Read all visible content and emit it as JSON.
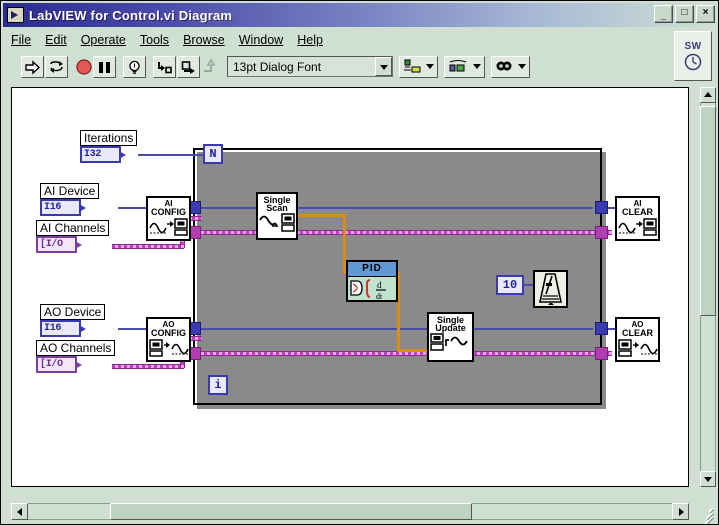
{
  "window": {
    "title": "LabVIEW for Control.vi Diagram",
    "icon": "labview-vi-icon",
    "buttons": [
      {
        "name": "minimize",
        "glyph": "_"
      },
      {
        "name": "maximize",
        "glyph": "□"
      },
      {
        "name": "close",
        "glyph": "×"
      }
    ]
  },
  "menu": {
    "items": [
      {
        "label": "File",
        "mnemonic": "F"
      },
      {
        "label": "Edit",
        "mnemonic": "E"
      },
      {
        "label": "Operate",
        "mnemonic": "O"
      },
      {
        "label": "Tools",
        "mnemonic": "T"
      },
      {
        "label": "Browse",
        "mnemonic": "B"
      },
      {
        "label": "Window",
        "mnemonic": "W"
      },
      {
        "label": "Help",
        "mnemonic": "H"
      }
    ]
  },
  "toolbar": {
    "run_icon": "run-arrow-icon",
    "run_continuous_icon": "run-continuously-icon",
    "abort_icon": "abort-execution-icon",
    "pause_icon": "pause-icon",
    "highlight_icon": "highlight-execution-lightbulb-icon",
    "step_into_icon": "step-into-icon",
    "step_over_icon": "step-over-icon",
    "step_out_icon": "step-out-icon",
    "font": {
      "value": "13pt Dialog Font",
      "dropdown_icon": "chevron-down-icon"
    },
    "align_objects_icon": "align-objects-icon",
    "distribute_objects_icon": "distribute-objects-icon",
    "reorder_icon": "reorder-objects-icon",
    "status_badge": {
      "label": "SW",
      "icon": "clock-icon"
    }
  },
  "diagram": {
    "terminals": [
      {
        "name": "iterations",
        "label": "Iterations",
        "type": "I32",
        "kind": "numeric"
      },
      {
        "name": "ai-device",
        "label": "AI Device",
        "type": "I16",
        "kind": "numeric"
      },
      {
        "name": "ai-channels",
        "label": "AI Channels",
        "type": "[I/O",
        "kind": "io-array"
      },
      {
        "name": "ao-device",
        "label": "AO Device",
        "type": "I16",
        "kind": "numeric"
      },
      {
        "name": "ao-channels",
        "label": "AO Channels",
        "type": "[I/O",
        "kind": "io-array"
      }
    ],
    "subvis": [
      {
        "name": "ai-config",
        "line1": "AI",
        "line2": "CONFIG",
        "icon": "ai-config-icon"
      },
      {
        "name": "ai-single-scan",
        "line1": "Single",
        "line2": "Scan",
        "icon": "ai-single-scan-icon"
      },
      {
        "name": "ai-clear",
        "line1": "AI",
        "line2": "CLEAR",
        "icon": "ai-clear-icon"
      },
      {
        "name": "ao-config",
        "line1": "AO",
        "line2": "CONFIG",
        "icon": "ao-config-icon"
      },
      {
        "name": "ao-single-update",
        "line1": "Single",
        "line2": "Update",
        "icon": "ao-single-update-icon"
      },
      {
        "name": "ao-clear",
        "line1": "AO",
        "line2": "CLEAR",
        "icon": "ao-clear-icon"
      }
    ],
    "pid": {
      "title": "PID",
      "icon": "pid-integral-derivative-icon",
      "header_color": "#5e9bd6",
      "body_color": "#bfe3cf"
    },
    "wait": {
      "constant": "10",
      "icon": "wait-until-next-ms-multiple-metronome-icon"
    },
    "loop": {
      "type": "for-loop",
      "count_terminal": "N",
      "index_terminal": "i"
    },
    "wire_colors": {
      "numeric_i16": "#4a4aa8",
      "io_channel": "#c23fc2",
      "dynamic_data": "#d98c16"
    }
  },
  "scrollbars": {
    "vertical": {
      "up_icon": "triangle-up-icon",
      "down_icon": "triangle-down-icon"
    },
    "horizontal": {
      "left_icon": "triangle-left-icon",
      "right_icon": "triangle-right-icon"
    },
    "resize_grip": "resize-grip-icon"
  }
}
